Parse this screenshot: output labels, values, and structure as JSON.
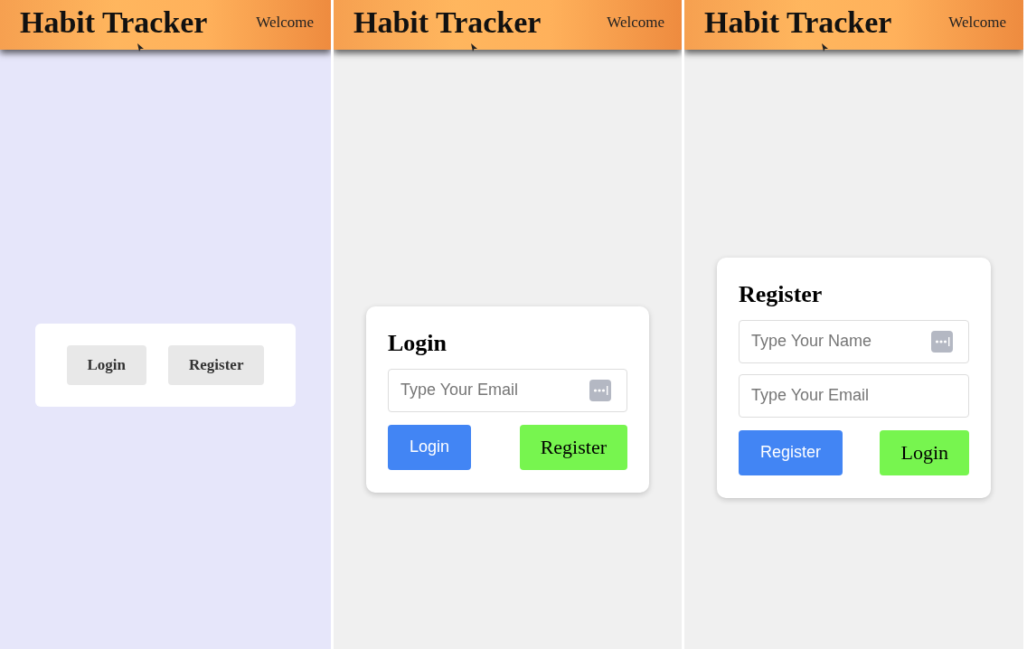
{
  "screens": [
    {
      "kind": "menu",
      "header": {
        "title": "Habit Tracker",
        "greeting": "Welcome"
      },
      "buttons": [
        {
          "label": "Login",
          "kind": "plain"
        },
        {
          "label": "Register",
          "kind": "plain"
        }
      ]
    },
    {
      "kind": "form",
      "header": {
        "title": "Habit Tracker",
        "greeting": "Welcome"
      },
      "title": "Login",
      "fields": [
        {
          "placeholder": "Type Your Email",
          "icon": true
        }
      ],
      "buttons": [
        {
          "label": "Login",
          "kind": "primary"
        },
        {
          "label": "Register",
          "kind": "secondary"
        }
      ]
    },
    {
      "kind": "form",
      "header": {
        "title": "Habit Tracker",
        "greeting": "Welcome"
      },
      "title": "Register",
      "fields": [
        {
          "placeholder": "Type Your Name",
          "icon": true
        },
        {
          "placeholder": "Type Your Email",
          "icon": false
        }
      ],
      "buttons": [
        {
          "label": "Register",
          "kind": "primary"
        },
        {
          "label": "Login",
          "kind": "secondary"
        }
      ]
    }
  ]
}
